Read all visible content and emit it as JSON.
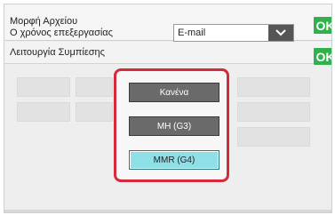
{
  "settings": {
    "file_format_label": "Μορφή Αρχείου",
    "processing_time_label": "Ο χρόνος επεξεργασίας",
    "delivery_select": {
      "value": "E-mail"
    },
    "ok_label_1": "OK",
    "compression_label": "Λειτουργία Συμπίεσης",
    "ok_label_2": "OK"
  },
  "compression_options": [
    {
      "label": "Κανένα",
      "selected": false
    },
    {
      "label": "MH (G3)",
      "selected": false
    },
    {
      "label": "MMR (G4)",
      "selected": true
    }
  ],
  "colors": {
    "ok_green": "#2fb24c",
    "highlight_red": "#d42a3c",
    "selected_cyan": "#8fe0e6",
    "option_gray": "#6a6a6a"
  },
  "icons": {
    "select_arrow": "chevron-down-icon"
  }
}
